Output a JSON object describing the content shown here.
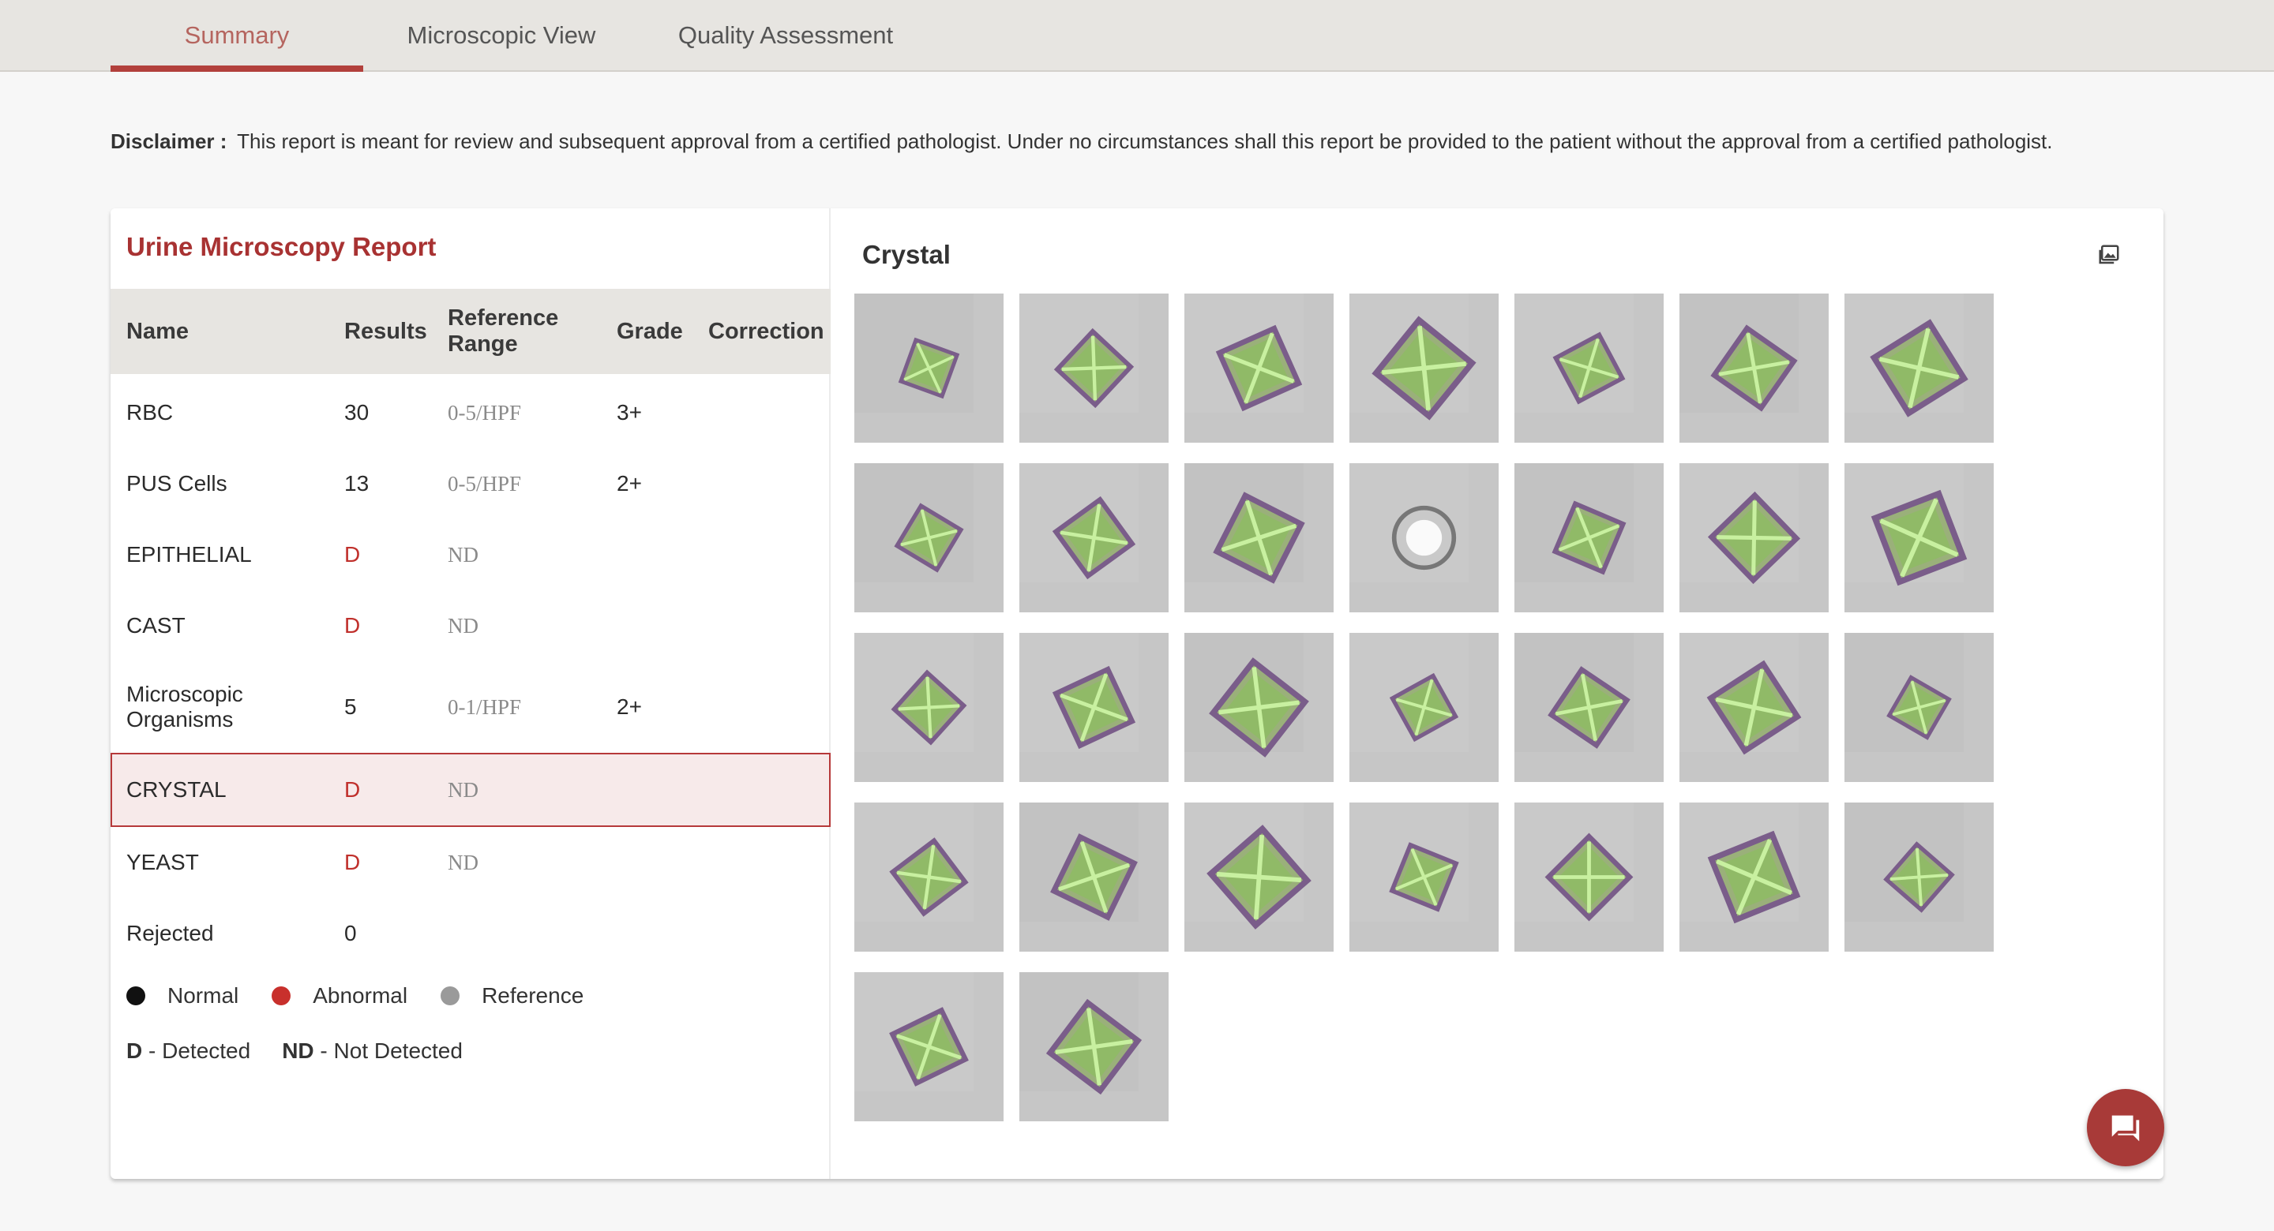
{
  "tabs": [
    {
      "label": "Summary",
      "active": true
    },
    {
      "label": "Microscopic View",
      "active": false
    },
    {
      "label": "Quality Assessment",
      "active": false
    }
  ],
  "disclaimer": {
    "label": "Disclaimer :",
    "text": "This report is meant for review and subsequent approval from a certified pathologist. Under no circumstances shall this report be provided to the patient without the approval from a certified pathologist."
  },
  "report": {
    "title": "Urine Microscopy Report",
    "columns": {
      "name": "Name",
      "results": "Results",
      "reference_range": "Reference Range",
      "grade": "Grade",
      "correction": "Correction"
    },
    "rows": [
      {
        "name": "RBC",
        "result": "30",
        "reference": "0-5/HPF",
        "grade": "3+",
        "status": "normal"
      },
      {
        "name": "PUS Cells",
        "result": "13",
        "reference": "0-5/HPF",
        "grade": "2+",
        "status": "normal"
      },
      {
        "name": "EPITHELIAL",
        "result": "D",
        "reference": "ND",
        "grade": "",
        "status": "abnormal"
      },
      {
        "name": "CAST",
        "result": "D",
        "reference": "ND",
        "grade": "",
        "status": "abnormal"
      },
      {
        "name": "Microscopic Organisms",
        "result": "5",
        "reference": "0-1/HPF",
        "grade": "2+",
        "status": "normal"
      },
      {
        "name": "CRYSTAL",
        "result": "D",
        "reference": "ND",
        "grade": "",
        "status": "abnormal",
        "selected": true
      },
      {
        "name": "YEAST",
        "result": "D",
        "reference": "ND",
        "grade": "",
        "status": "abnormal"
      },
      {
        "name": "Rejected",
        "result": "0",
        "reference": "",
        "grade": "",
        "status": "normal"
      }
    ],
    "legend": [
      {
        "label": "Normal",
        "color": "#111111"
      },
      {
        "label": "Abnormal",
        "color": "#c8302c"
      },
      {
        "label": "Reference",
        "color": "#9a9a9a"
      }
    ],
    "abbreviations": [
      {
        "abbr": "D",
        "text": "- Detected"
      },
      {
        "abbr": "ND",
        "text": "- Not Detected"
      }
    ]
  },
  "gallery": {
    "title": "Crystal",
    "icon": "image-gallery-icon",
    "image_count": 30
  },
  "chat_button": {
    "icon": "chat-icon"
  },
  "colors": {
    "accent": "#b2403c",
    "abnormal": "#c0302c",
    "header_bg": "#e7e5e1"
  }
}
